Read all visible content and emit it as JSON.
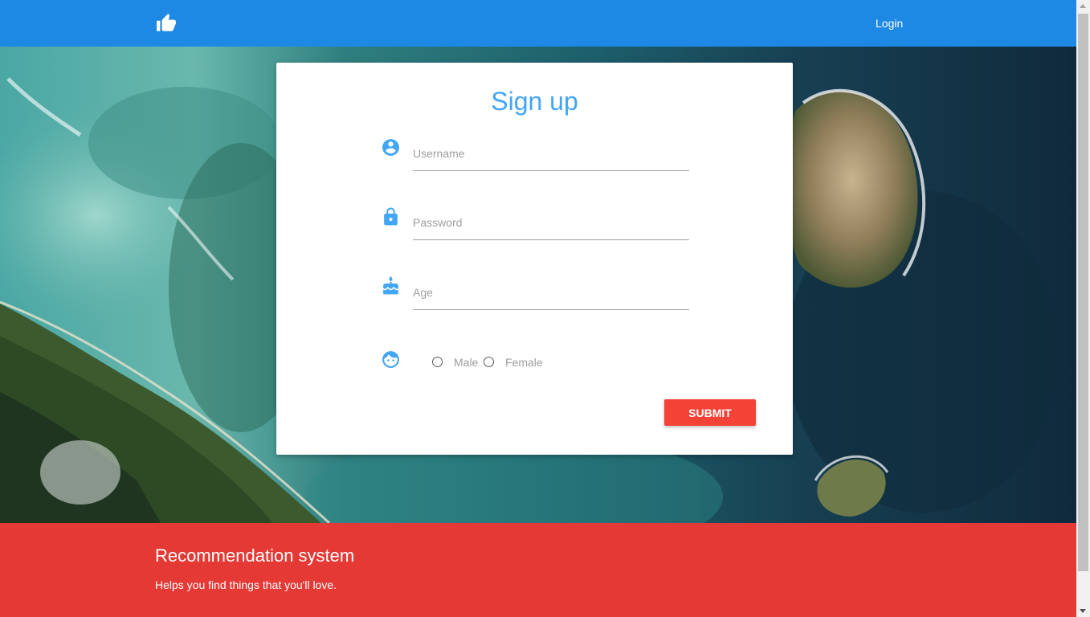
{
  "nav": {
    "logo_icon": "thumbs-up-icon",
    "login_label": "Login",
    "background_color": "#1e88e5"
  },
  "signup": {
    "title": "Sign up",
    "username": {
      "icon": "account-circle-icon",
      "placeholder": "Username",
      "value": ""
    },
    "password": {
      "icon": "lock-icon",
      "placeholder": "Password",
      "value": ""
    },
    "age": {
      "icon": "cake-icon",
      "placeholder": "Age",
      "value": ""
    },
    "gender": {
      "icon": "face-icon",
      "options": [
        {
          "label": "Male",
          "checked": false
        },
        {
          "label": "Female",
          "checked": false
        }
      ]
    },
    "submit_label": "SUBMIT",
    "accent_color": "#42a5f5",
    "submit_color": "#f44336"
  },
  "footer": {
    "title": "Recommendation system",
    "tagline": "Helps you find things that you'll love.",
    "background_color": "#e53935"
  }
}
